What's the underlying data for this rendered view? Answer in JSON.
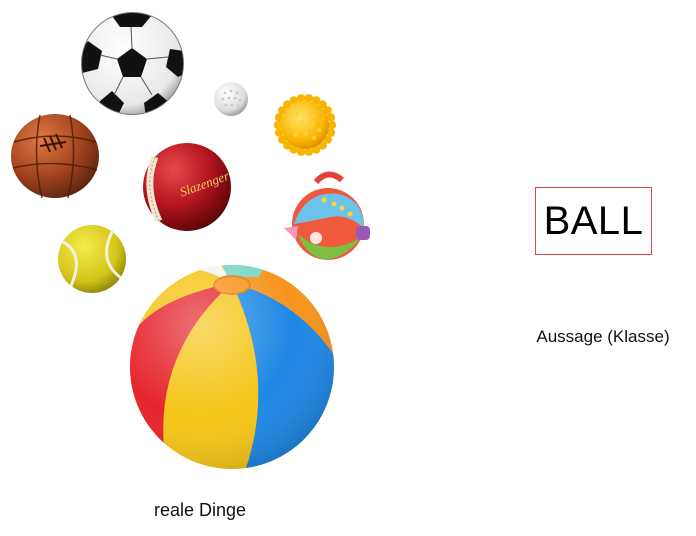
{
  "labels": {
    "real_things": "reale Dinge",
    "concept_word": "BALL",
    "concept_caption": "Aussage (Klasse)",
    "cricket_brand": "Slazenger"
  },
  "balls": [
    {
      "name": "soccer-ball-icon"
    },
    {
      "name": "golf-ball-icon"
    },
    {
      "name": "spiky-massage-ball-icon"
    },
    {
      "name": "leather-football-icon"
    },
    {
      "name": "cricket-ball-icon"
    },
    {
      "name": "baby-toy-ball-icon"
    },
    {
      "name": "tennis-ball-icon"
    },
    {
      "name": "beach-ball-icon"
    }
  ],
  "colors": {
    "box_border": "#e0484d",
    "beach_red": "#e5252c",
    "beach_yellow": "#f5c518",
    "beach_blue": "#1e88e5",
    "beach_orange": "#f7941d"
  }
}
